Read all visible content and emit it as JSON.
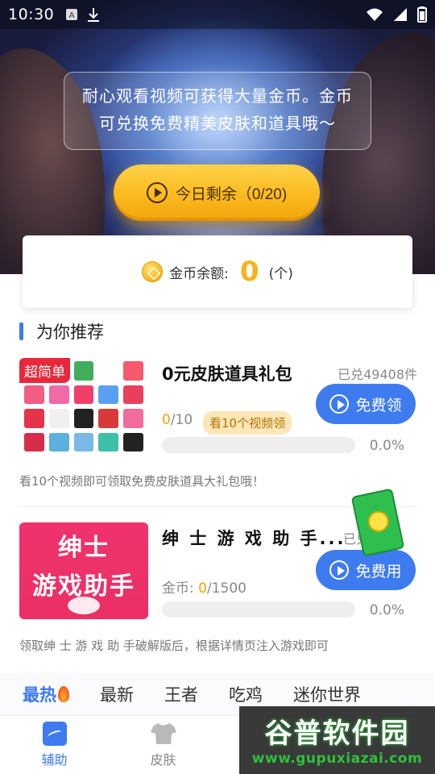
{
  "status_bar": {
    "time": "10:30",
    "icons": [
      "a-icon",
      "download-icon",
      "wifi-icon",
      "signal-icon",
      "battery-icon"
    ]
  },
  "hero": {
    "notice": "耐心观看视频可获得大量金币。金币可兑换免费精美皮肤和道具哦～",
    "today_button_label": "今日剩余（0/20)"
  },
  "coin": {
    "label": "金币余额:",
    "value": "0",
    "unit": "(个)"
  },
  "section": {
    "title": "为你推荐"
  },
  "items": [
    {
      "tag": "超简单",
      "title": "0元皮肤道具礼包",
      "redeemed": "已兑49408件",
      "button_label": "免费领",
      "progress_current": "0",
      "progress_total": "/10",
      "watch_tag": "看10个视频领",
      "progress_fraction": 0,
      "percent": "0.0%",
      "description": "看10个视频即可领取免费皮肤道具大礼包哦！"
    },
    {
      "thumb_line1": "绅士",
      "thumb_line2": "游戏助手",
      "title": "绅 士 游 戏 助 手...",
      "redeemed": "已兑",
      "button_label": "免费用",
      "progress_prefix": "金币: ",
      "progress_current": "0",
      "progress_total": "/1500",
      "progress_fraction": 0,
      "percent": "0.0%",
      "description": "领取绅 士 游 戏 助 手破解版后，根据详情页注入游戏即可"
    }
  ],
  "categories": [
    {
      "label": "最热",
      "active": true
    },
    {
      "label": "最新",
      "active": false
    },
    {
      "label": "王者",
      "active": false
    },
    {
      "label": "吃鸡",
      "active": false
    },
    {
      "label": "迷你世界",
      "active": false
    }
  ],
  "tabs": [
    {
      "label": "辅助",
      "active": true
    },
    {
      "label": "皮肤",
      "active": false
    }
  ],
  "watermark": {
    "text": "谷普软件园",
    "url": "www.gupuxiazai.com"
  },
  "colors": {
    "accent": "#3d7bef",
    "gold": "#f5b41a",
    "tag_red": "#e8283a"
  }
}
